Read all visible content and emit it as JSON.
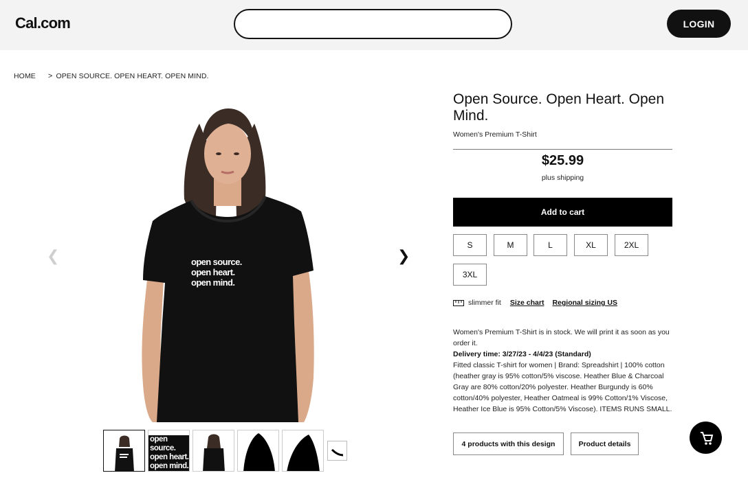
{
  "header": {
    "logo": "Cal.com",
    "search": {
      "value": "",
      "placeholder": ""
    },
    "login_label": "LOGIN"
  },
  "breadcrumb": {
    "home": "HOME",
    "separator": ">",
    "current": "OPEN SOURCE. OPEN HEART. OPEN MIND."
  },
  "gallery": {
    "shirt_print": [
      "open source.",
      "open heart.",
      "open mind."
    ],
    "thumbnail_text": [
      "open source.",
      "open heart.",
      "open mind."
    ],
    "prev_icon": "chevron-left-icon",
    "next_icon": "chevron-right-icon"
  },
  "product": {
    "title": "Open Source. Open Heart. Open Mind.",
    "subtitle": "Women's Premium T-Shirt",
    "price": "$25.99",
    "shipping": "plus shipping",
    "add_to_cart": "Add to cart",
    "sizes": [
      "S",
      "M",
      "L",
      "XL",
      "2XL",
      "3XL"
    ],
    "fit": "slimmer fit",
    "size_chart": "Size chart",
    "regional_sizing": "Regional sizing US",
    "stock_text": "Women's Premium T-Shirt is in stock. We will print it as soon as you order it.",
    "delivery": "Delivery time: 3/27/23 - 4/4/23 (Standard)",
    "details_text": "Fitted classic T-shirt for women | Brand: Spreadshirt | 100% cotton (heather gray is 95% cotton/5% viscose. Heather Blue & Charcoal Gray are 80% cotton/20% polyester. Heather Burgundy is 60% cotton/40% polyester, Heather Oatmeal is 99% Cotton/1% Viscose, Heather Ice Blue is 95% Cotton/5% Viscose). ITEMS RUNS SMALL.",
    "products_with_design": "4 products with this design",
    "product_details": "Product details"
  },
  "colors": {
    "accent": "#000000",
    "header_bg": "#f3f3f3",
    "shirt": "#111111"
  }
}
